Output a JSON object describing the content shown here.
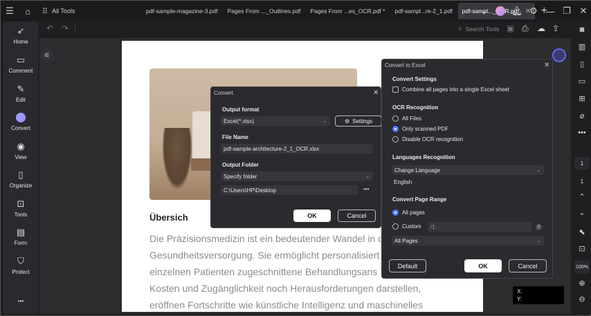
{
  "titlebar": {
    "all_tools": "All Tools",
    "tabs": [
      {
        "label": "pdf-sample-magazine-3.pdf"
      },
      {
        "label": "Pages  From ..._Outlines.pdf"
      },
      {
        "label": "Pages  From ...es_OCR.pdf *"
      },
      {
        "label": "pdf-sampl...re-2_1.pdf"
      },
      {
        "label": "pdf-sampl..._OCR.pdf"
      }
    ]
  },
  "sidebar": {
    "items": [
      {
        "label": "Home"
      },
      {
        "label": "Comment"
      },
      {
        "label": "Edit"
      },
      {
        "label": "Convert"
      },
      {
        "label": "View"
      },
      {
        "label": "Organize"
      },
      {
        "label": "Tools"
      },
      {
        "label": "Form"
      },
      {
        "label": "Protect"
      }
    ],
    "more": "•••"
  },
  "toolbar": {
    "search_tools": "Search Tools"
  },
  "document": {
    "heading": "Übersich",
    "lines": [
      "Die Präzisionsmedizin ist ein bedeutender Wandel in d",
      "Gesundheitsversorgung. Sie ermöglicht personalisiert",
      "einzelnen Patienten zugeschnittene Behandlungsans",
      "Kosten und Zugänglichkeit noch Herausforderungen darstellen,",
      "eröffnen Fortschritte wie künstliche Intelligenz und maschinelles"
    ]
  },
  "rail": {
    "page_number": "1",
    "page_total": "1",
    "zoom": "100%"
  },
  "coords": {
    "x_label": "X:",
    "y_label": "Y:"
  },
  "convert_dialog": {
    "title": "Convert",
    "output_format_label": "Output format",
    "output_format_value": "Excel(*.xlsx)",
    "settings_label": "Settings",
    "file_name_label": "File Name",
    "file_name_value": "pdf-sample-architecture-2_1_OCR.xlsx",
    "output_folder_label": "Output Folder",
    "folder_option": "Specify folder",
    "folder_path": "C:\\Users\\HP\\Desktop",
    "more": "•••",
    "ok_label": "OK",
    "cancel_label": "Cancel"
  },
  "excel_dialog": {
    "title": "Convert to Excel",
    "convert_settings": "Convert Settings",
    "combine_label": "Combine all pages into a single Excel sheet",
    "ocr_title": "OCR Recognition",
    "ocr_options": [
      "All Files",
      "Only scanned PDF",
      "Disable OCR recognition"
    ],
    "ocr_selected": 1,
    "lang_title": "Languages Recognition",
    "change_language": "Change Language",
    "language": "English",
    "range_title": "Convert Page Range",
    "all_pages": "All pages",
    "custom": "Custom",
    "custom_placeholder": "/1",
    "pages_option": "All Pages",
    "default_label": "Default",
    "ok_label": "OK",
    "cancel_label": "Cancel"
  }
}
